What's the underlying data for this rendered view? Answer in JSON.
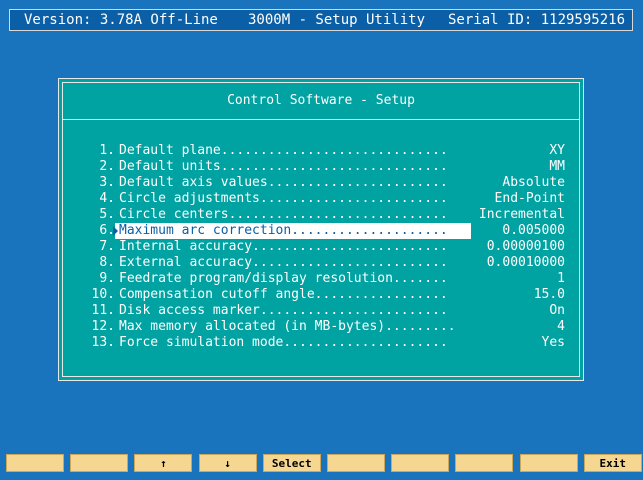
{
  "header": {
    "version": "Version: 3.78A Off-Line",
    "utility": "3000M - Setup Utility",
    "serial": "Serial ID: 1129595216"
  },
  "panel": {
    "title": "Control Software - Setup",
    "selected_index": 6,
    "items": [
      {
        "num": "1.",
        "label": "Default plane.............................",
        "value": "XY"
      },
      {
        "num": "2.",
        "label": "Default units.............................",
        "value": "MM"
      },
      {
        "num": "3.",
        "label": "Default axis values.......................",
        "value": "Absolute"
      },
      {
        "num": "4.",
        "label": "Circle adjustments........................",
        "value": "End-Point"
      },
      {
        "num": "5.",
        "label": "Circle centers............................",
        "value": "Incremental"
      },
      {
        "num": "6.",
        "label": "Maximum arc correction....................",
        "value": "0.005000"
      },
      {
        "num": "7.",
        "label": "Internal accuracy.........................",
        "value": "0.00000100"
      },
      {
        "num": "8.",
        "label": "External accuracy.........................",
        "value": "0.00010000"
      },
      {
        "num": "9.",
        "label": "Feedrate program/display resolution.......",
        "value": "1"
      },
      {
        "num": "10.",
        "label": "Compensation cutoff angle.................",
        "value": "15.0"
      },
      {
        "num": "11.",
        "label": "Disk access marker........................",
        "value": "On"
      },
      {
        "num": "12.",
        "label": "Max memory allocated (in MB-bytes).........",
        "value": "4"
      },
      {
        "num": "13.",
        "label": "Force simulation mode.....................",
        "value": "Yes"
      }
    ]
  },
  "fkeys": [
    {
      "label": ""
    },
    {
      "label": ""
    },
    {
      "label": "↑"
    },
    {
      "label": "↓"
    },
    {
      "label": "Select"
    },
    {
      "label": ""
    },
    {
      "label": ""
    },
    {
      "label": ""
    },
    {
      "label": ""
    },
    {
      "label": "Exit"
    }
  ],
  "colors": {
    "background": "#1a73bd",
    "titlebar": "#0a5fa6",
    "panel": "#00a2a2",
    "fkey": "#f6d792",
    "selection": "#ffffff"
  }
}
